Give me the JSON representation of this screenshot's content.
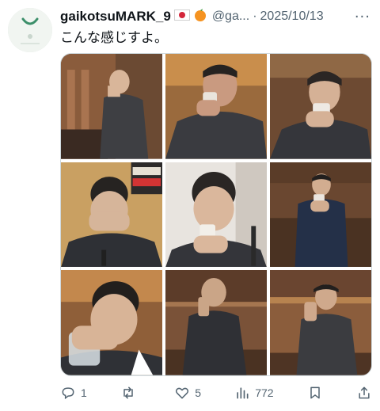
{
  "post": {
    "display_name": "gaikotsuMARK_9",
    "handle": "@ga...",
    "separator": "·",
    "date": "2025/10/13",
    "more_icon": "more-horizontal-icon",
    "text": "こんな感じすよ。",
    "flag_icon": "japan-flag-icon",
    "fruit_icon": "tangerine-icon"
  },
  "media": {
    "count": 9,
    "columns": 3,
    "rows": 3
  },
  "actions": {
    "reply_count": "1",
    "retweet_count": "",
    "like_count": "5",
    "view_count": "772",
    "icons": [
      "reply-icon",
      "retweet-icon",
      "like-icon",
      "views-icon",
      "bookmark-icon",
      "share-icon"
    ]
  },
  "colors": {
    "text": "#0f1419",
    "secondary": "#536471",
    "border": "#cfd9de"
  }
}
